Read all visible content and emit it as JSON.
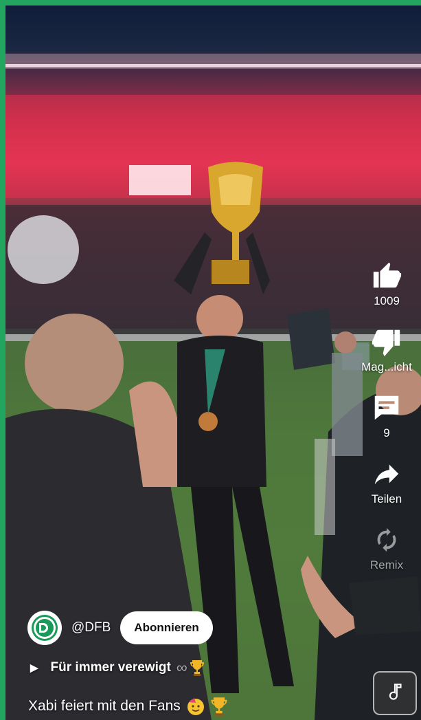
{
  "actions": {
    "like": {
      "count": "1009"
    },
    "dislike": {
      "label": "Mag...icht"
    },
    "comments": {
      "count": "9"
    },
    "share": {
      "label": "Teilen"
    },
    "remix": {
      "label": "Remix"
    }
  },
  "channel": {
    "handle": "@DFB",
    "subscribe_label": "Abonnieren"
  },
  "song": {
    "title": "Für immer verewigt",
    "loop_glyph": "∞"
  },
  "caption": {
    "text": "Xabi feiert mit den Fans"
  },
  "colors": {
    "frame_border": "#21a55f",
    "subscribe_bg": "#ffffff",
    "stadium_red": "#e23a5a"
  }
}
